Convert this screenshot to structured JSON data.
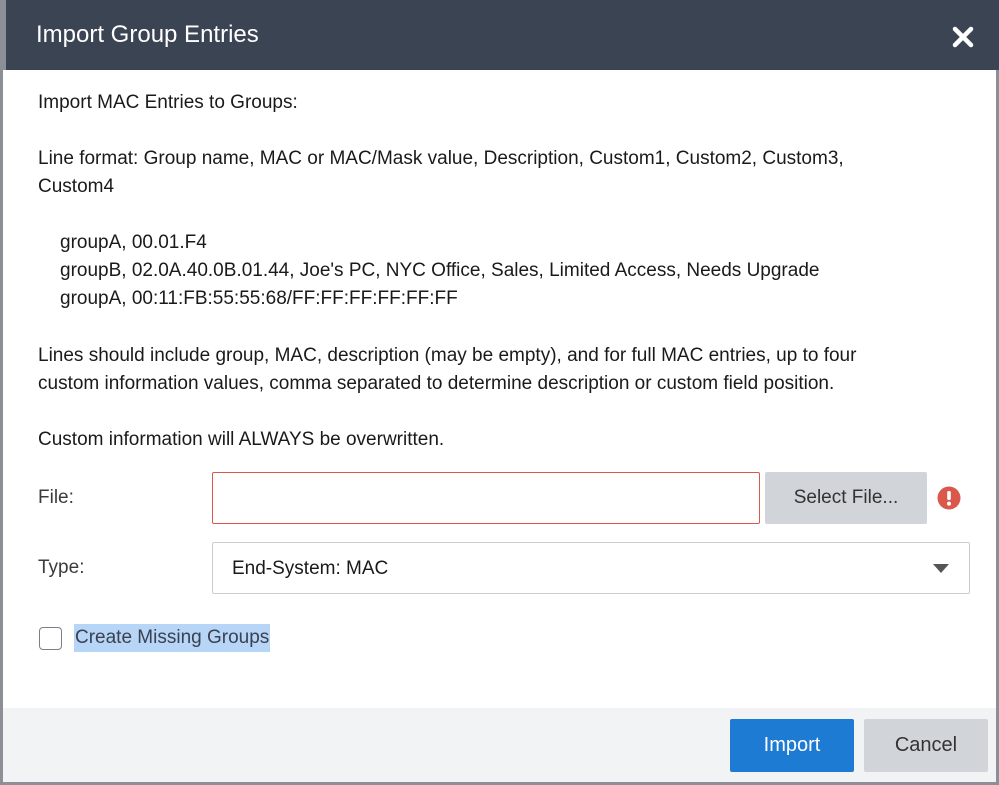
{
  "dialog": {
    "title": "Import Group Entries",
    "close_icon": "close-icon"
  },
  "instructions": {
    "heading": "Import MAC Entries to Groups:",
    "line_format_1": "Line format: Group name, MAC or MAC/Mask value, Description, Custom1, Custom2, Custom3,",
    "line_format_2": "Custom4",
    "examples": [
      "groupA, 00.01.F4",
      "groupB, 02.0A.40.0B.01.44, Joe's PC, NYC Office, Sales, Limited Access, Needs Upgrade",
      "groupA, 00:11:FB:55:55:68/FF:FF:FF:FF:FF:FF"
    ],
    "note_1": "Lines should include group, MAC, description (may be empty), and for full MAC entries, up to four",
    "note_2": "custom information values, comma separated to determine description or custom field position.",
    "warning": "Custom information will ALWAYS be overwritten."
  },
  "form": {
    "file_label": "File:",
    "file_value": "",
    "select_file_label": "Select File...",
    "error_icon": "error-icon",
    "type_label": "Type:",
    "type_value": "End-System: MAC",
    "create_missing_label": "Create Missing Groups",
    "create_missing_checked": false
  },
  "footer": {
    "import_label": "Import",
    "cancel_label": "Cancel"
  },
  "colors": {
    "titlebar": "#3a4452",
    "primary": "#1e7bd4",
    "error": "#d9574b",
    "highlight": "#b6d5f7"
  }
}
